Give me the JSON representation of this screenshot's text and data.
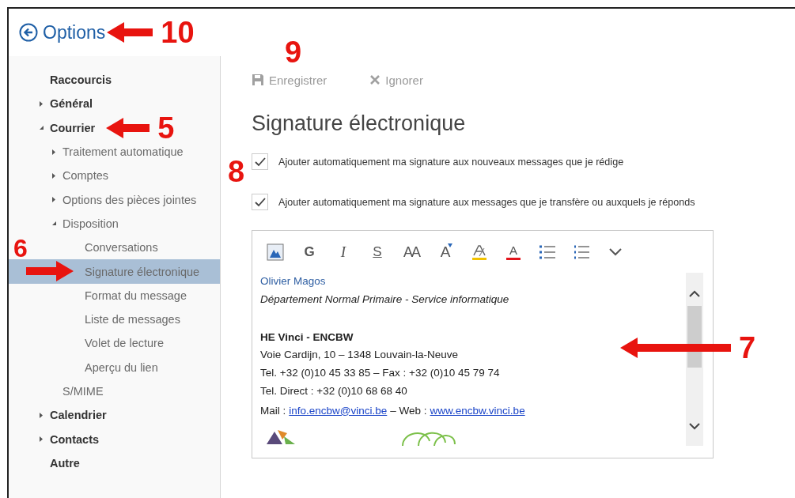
{
  "header": {
    "title": "Options",
    "annotation": {
      "label": "10",
      "kind": "left"
    }
  },
  "nav": [
    {
      "label": "Raccourcis",
      "selected": false
    },
    {
      "label": "Général",
      "expanded": false,
      "selected": false
    },
    {
      "label": "Courrier",
      "expanded": true,
      "selected": false,
      "annotation": {
        "label": "5",
        "kind": "left"
      },
      "children": [
        {
          "label": "Traitement automatique",
          "expanded": false,
          "selected": false
        },
        {
          "label": "Comptes",
          "expanded": false,
          "selected": false
        },
        {
          "label": "Options des pièces jointes",
          "expanded": false,
          "selected": false
        },
        {
          "label": "Disposition",
          "expanded": true,
          "selected": false,
          "children": [
            {
              "label": "Conversations",
              "selected": false
            },
            {
              "label": "Signature électronique",
              "selected": true,
              "annotation": {
                "label": "6",
                "kind": "right"
              }
            },
            {
              "label": "Format du message",
              "selected": false
            },
            {
              "label": "Liste de messages",
              "selected": false
            },
            {
              "label": "Volet de lecture",
              "selected": false
            },
            {
              "label": "Aperçu du lien",
              "selected": false
            }
          ]
        },
        {
          "label": "S/MIME",
          "selected": false
        }
      ]
    },
    {
      "label": "Calendrier",
      "expanded": false,
      "selected": false
    },
    {
      "label": "Contacts",
      "expanded": false,
      "selected": false
    },
    {
      "label": "Autre",
      "selected": false
    }
  ],
  "toolbar": {
    "annotation": {
      "label": "9"
    },
    "buttons": [
      {
        "kind": "save",
        "label": "Enregistrer",
        "disabled": true
      },
      {
        "kind": "discard",
        "label": "Ignorer",
        "disabled": true
      }
    ]
  },
  "heading": "Signature électronique",
  "options": {
    "annotation": {
      "label": "8"
    },
    "items": [
      {
        "label": "Ajouter automatiquement ma signature aux nouveaux messages que je rédige",
        "checked": true
      },
      {
        "label": "Ajouter automatiquement ma signature aux messages que je transfère ou auxquels je réponds",
        "checked": true
      }
    ]
  },
  "editor": {
    "annotation": {
      "label": "7",
      "kind": "left"
    },
    "tools": [
      {
        "kind": "image"
      },
      {
        "kind": "bold",
        "label": "G"
      },
      {
        "kind": "italic",
        "label": "I"
      },
      {
        "kind": "underline",
        "label": "S"
      },
      {
        "kind": "size",
        "label": "AA"
      },
      {
        "kind": "grow",
        "label": "A"
      },
      {
        "kind": "highlight"
      },
      {
        "kind": "color",
        "label": "A"
      },
      {
        "kind": "bullets"
      },
      {
        "kind": "numbering"
      },
      {
        "kind": "more"
      }
    ],
    "lines": [
      {
        "kind": "name",
        "text": "Olivier Magos"
      },
      {
        "kind": "italic",
        "text": "Département Normal Primaire - Service informatique"
      },
      {
        "kind": "heading",
        "text": "HE Vinci - ENCBW"
      },
      {
        "kind": "plain",
        "text": "Voie Cardijn, 10 – 1348 Louvain-la-Neuve"
      },
      {
        "kind": "plain",
        "text": "Tel. +32 (0)10 45 33 85 – Fax : +32 (0)10 45 79 74"
      },
      {
        "kind": "plain",
        "text": "Tel. Direct : +32 (0)10 68 68 40"
      },
      {
        "kind": "mixed",
        "parts": [
          {
            "text": "Mail :"
          },
          {
            "text": "info.encbw@vinci.be",
            "link": true
          },
          {
            "text": "– Web :"
          },
          {
            "text": "www.encbw.vinci.be",
            "link": true
          }
        ]
      }
    ]
  }
}
